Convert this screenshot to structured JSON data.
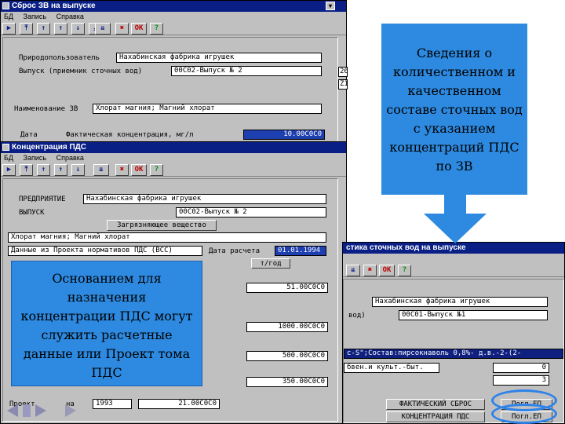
{
  "win1": {
    "title": "Сброс ЗВ на выпуске",
    "menu": [
      "БД",
      "Запись",
      "Справка"
    ],
    "ok": "OK",
    "q": "?",
    "nature_user_label": "Природопользователь",
    "nature_user_value": "Нахабинская фабрика игрушек",
    "outlet_label": "Выпуск (приемник сточных вод)",
    "outlet_value": "00С02-Выпуск № 2",
    "zv_label": "Наименование ЗВ",
    "zv_value": "Хлорат магния; Магний хлорат",
    "date_label": "Дата",
    "fact_label": "Фактическая концентрация, мг/л",
    "fact_value": "10.00С0С0",
    "side_frag": [
      "26",
      "Z1"
    ]
  },
  "win2": {
    "title": "Концентрация ПДС",
    "menu": [
      "БД",
      "Запись",
      "Справка"
    ],
    "ok": "OK",
    "q": "?",
    "enterprise_label": "ПРЕДПРИЯТИЕ",
    "enterprise_value": "Нахабинская фабрика игрушек",
    "outlet_label": "ВЫПУСК",
    "outlet_value": "00С02-Выпуск № 2",
    "pollutant_header": "Загрязняющее вещество",
    "pollutant_value": "Хлорат магния; Магний хлорат",
    "calc_date_label": "Дата расчета",
    "calc_date_value": "01.01.1994",
    "pds_data_label": "Данные из Проекта нормативов ПДС (ВСС)",
    "unit_label": "т/год",
    "values": [
      "51.00С0С0",
      "1000.00С0С0",
      "500.00С0С0",
      "350.00С0С0"
    ],
    "project_label": "Проект",
    "project_frag": "на",
    "project_year": "1993",
    "project_value": "21.00С0С0"
  },
  "win3": {
    "title": "стика сточных вод на выпуске",
    "ok": "OK",
    "q": "?",
    "enterprise_value": "Нахабинская фабрика игрушек",
    "outlet_label": "вод)",
    "outlet_value": "00С01-Выпуск №1",
    "composition_value": "с-S\";Состав:пирсокнаволь 0,8%- д.в.-2-(2-",
    "purpose_value": "бвен.и культ.-быт.",
    "right_vals": [
      "0",
      "3"
    ],
    "btn_fact": "ФАКТИЧЕСКИЙ СБРОС",
    "btn_pds": "КОНЦЕНТРАЦИЯ ПДС",
    "btn_calc1": "Погл.ЕП",
    "btn_calc2": "Погл.ЕП"
  },
  "callout_top": "Сведения о количественном и качественном составе сточных вод с указанием концентраций ПДС по ЗВ",
  "callout_left": "Основанием для назначения концентрации ПДС могут служить расчетные данные или Проект тома ПДС",
  "colors": {
    "titlebar": "#0a1f86",
    "callout": "#2d8ae0",
    "window": "#c0c0c0"
  },
  "icons": [
    "nav-first-icon",
    "nav-prev-icon",
    "nav-up-icon",
    "nav-down-icon",
    "nav-next-icon",
    "nav-last-icon",
    "delete-icon",
    "ok-icon",
    "help-icon"
  ]
}
